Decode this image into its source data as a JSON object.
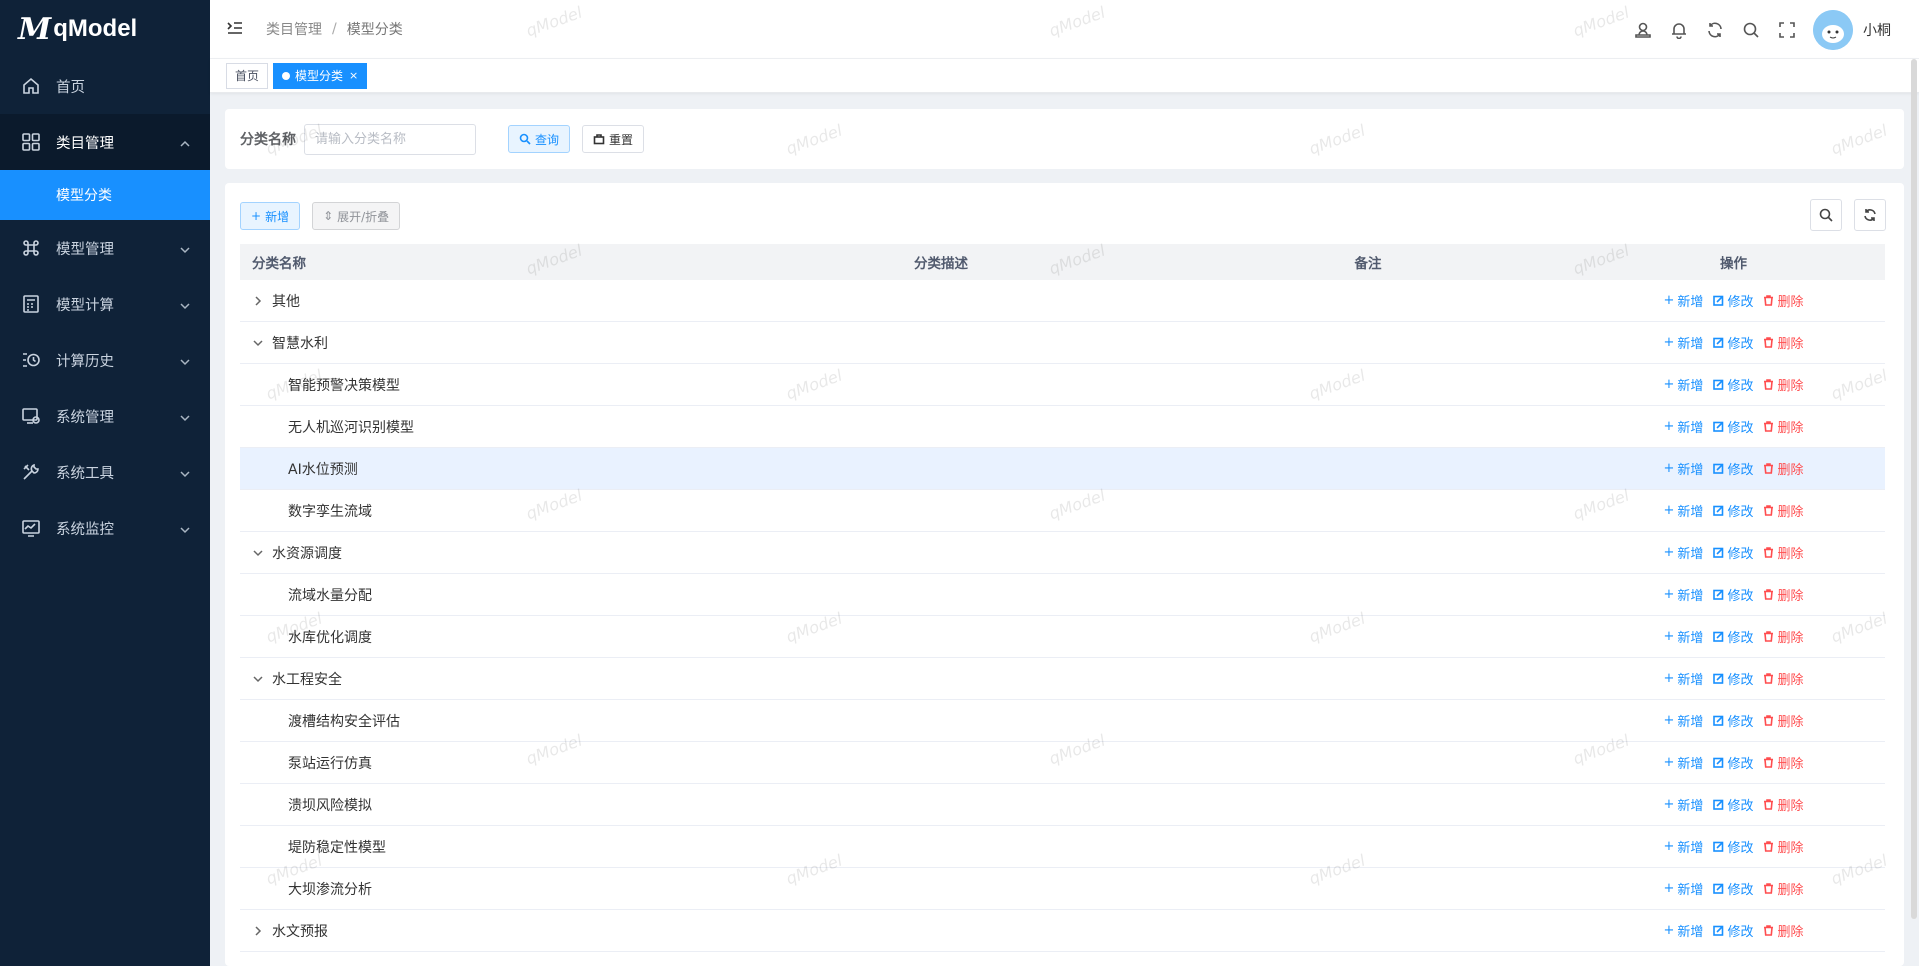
{
  "app": {
    "logo_mark": "M",
    "logo_text": "qModel"
  },
  "sidebar": {
    "items": [
      {
        "label": "首页",
        "icon": "home-icon",
        "expandable": false
      },
      {
        "label": "类目管理",
        "icon": "grid-icon",
        "expandable": true,
        "open": true,
        "children": [
          {
            "label": "模型分类",
            "active": true
          }
        ]
      },
      {
        "label": "模型管理",
        "icon": "command-icon",
        "expandable": true
      },
      {
        "label": "模型计算",
        "icon": "calculator-icon",
        "expandable": true
      },
      {
        "label": "计算历史",
        "icon": "history-icon",
        "expandable": true
      },
      {
        "label": "系统管理",
        "icon": "system-settings-icon",
        "expandable": true
      },
      {
        "label": "系统工具",
        "icon": "tools-icon",
        "expandable": true
      },
      {
        "label": "系统监控",
        "icon": "monitor-icon",
        "expandable": true
      }
    ]
  },
  "header": {
    "breadcrumb": [
      "类目管理",
      "模型分类"
    ],
    "username": "小桐",
    "icons": [
      "user-icon",
      "bell-icon",
      "refresh-icon",
      "search-icon",
      "fullscreen-icon"
    ]
  },
  "tags": [
    {
      "label": "首页",
      "active": false
    },
    {
      "label": "模型分类",
      "active": true,
      "close": "×"
    }
  ],
  "search": {
    "label": "分类名称",
    "placeholder": "请输入分类名称",
    "value": "",
    "query_label": "查询",
    "reset_label": "重置"
  },
  "toolbar": {
    "add_label": "新增",
    "expand_label": "展开/折叠"
  },
  "table": {
    "columns": [
      "分类名称",
      "分类描述",
      "备注",
      "操作"
    ],
    "ops": {
      "add": "新增",
      "edit": "修改",
      "delete": "删除"
    },
    "rows": [
      {
        "name": "其他",
        "level": 0,
        "arrow": "right"
      },
      {
        "name": "智慧水利",
        "level": 0,
        "arrow": "down"
      },
      {
        "name": "智能预警决策模型",
        "level": 1
      },
      {
        "name": "无人机巡河识别模型",
        "level": 1
      },
      {
        "name": "AI水位预测",
        "level": 1,
        "highlight": true
      },
      {
        "name": "数字孪生流域",
        "level": 1
      },
      {
        "name": "水资源调度",
        "level": 0,
        "arrow": "down"
      },
      {
        "name": "流域水量分配",
        "level": 1
      },
      {
        "name": "水库优化调度",
        "level": 1
      },
      {
        "name": "水工程安全",
        "level": 0,
        "arrow": "down"
      },
      {
        "name": "渡槽结构安全评估",
        "level": 1
      },
      {
        "name": "泵站运行仿真",
        "level": 1
      },
      {
        "name": "溃坝风险模拟",
        "level": 1
      },
      {
        "name": "堤防稳定性模型",
        "level": 1
      },
      {
        "name": "大坝渗流分析",
        "level": 1
      },
      {
        "name": "水文预报",
        "level": 0,
        "arrow": "right"
      }
    ]
  },
  "watermark_text": "qModel",
  "colors": {
    "sidebar_bg": "#0f2238",
    "primary": "#1890ff",
    "danger": "#ff4d4f"
  }
}
